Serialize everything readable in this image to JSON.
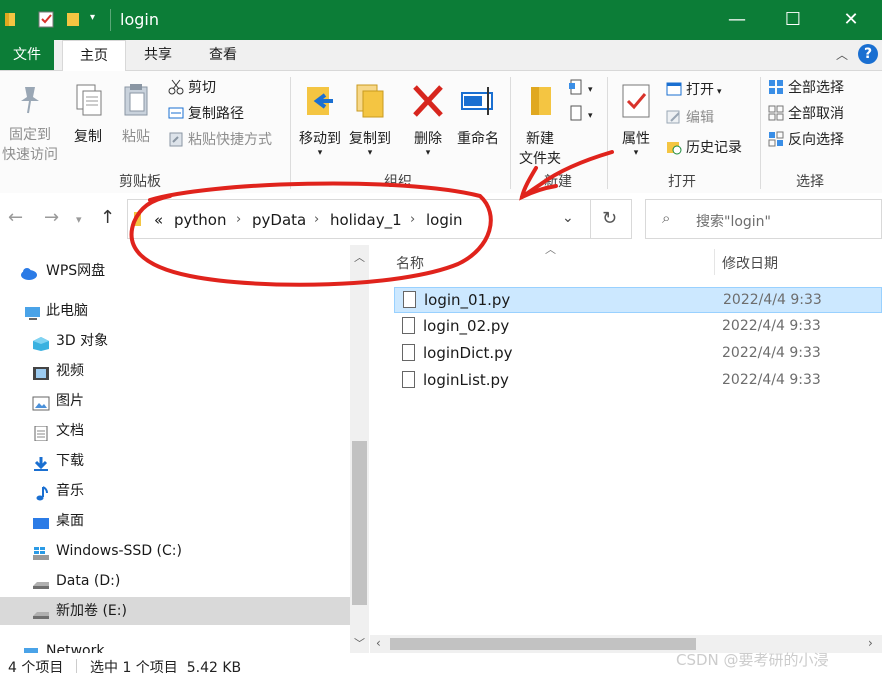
{
  "window": {
    "title": "login",
    "controls": {
      "minimize": "—",
      "maximize": "☐",
      "close": "✕"
    }
  },
  "tabs": [
    "文件",
    "主页",
    "共享",
    "查看"
  ],
  "active_tab": "主页",
  "ribbon": {
    "clipboard": {
      "label": "剪贴板",
      "pin": "固定到\n快速访问",
      "copy": "复制",
      "paste": "粘贴",
      "cut": "剪切",
      "copy_path": "复制路径",
      "paste_shortcut": "粘贴快捷方式"
    },
    "organize": {
      "label": "组织",
      "move_to": "移动到",
      "copy_to": "复制到",
      "delete": "删除",
      "rename": "重命名"
    },
    "new": {
      "label": "新建",
      "new_folder": "新建\n文件夹"
    },
    "open": {
      "label": "打开",
      "properties": "属性",
      "open": "打开",
      "edit": "编辑",
      "history": "历史记录"
    },
    "select": {
      "label": "选择",
      "select_all": "全部选择",
      "select_none": "全部取消",
      "invert": "反向选择"
    }
  },
  "address": {
    "overflow": "«",
    "crumbs": [
      "python",
      "pyData",
      "holiday_1",
      "login"
    ]
  },
  "search": {
    "placeholder": "搜索\"login\""
  },
  "nav": [
    {
      "label": "WPS网盘",
      "icon": "cloud-icon"
    },
    {
      "label": "此电脑",
      "icon": "computer-icon"
    },
    {
      "label": "3D 对象",
      "icon": "3d-objects-icon"
    },
    {
      "label": "视频",
      "icon": "video-icon"
    },
    {
      "label": "图片",
      "icon": "pictures-icon"
    },
    {
      "label": "文档",
      "icon": "documents-icon"
    },
    {
      "label": "下载",
      "icon": "download-icon"
    },
    {
      "label": "音乐",
      "icon": "music-icon"
    },
    {
      "label": "桌面",
      "icon": "desktop-icon"
    },
    {
      "label": "Windows-SSD (C:)",
      "icon": "windows-drive-icon"
    },
    {
      "label": "Data (D:)",
      "icon": "drive-icon"
    },
    {
      "label": "新加卷 (E:)",
      "icon": "drive-icon"
    },
    {
      "label": "Network",
      "icon": "network-icon"
    }
  ],
  "nav_selected": "新加卷 (E:)",
  "columns": {
    "name": "名称",
    "modified": "修改日期"
  },
  "files": [
    {
      "name": "login_01.py",
      "modified": "2022/4/4 9:33",
      "selected": true
    },
    {
      "name": "login_02.py",
      "modified": "2022/4/4 9:33",
      "selected": false
    },
    {
      "name": "loginDict.py",
      "modified": "2022/4/4 9:33",
      "selected": false
    },
    {
      "name": "loginList.py",
      "modified": "2022/4/4 9:33",
      "selected": false
    }
  ],
  "status": {
    "count": "4 个项目",
    "selection": "选中 1 个项目  5.42 KB"
  },
  "watermark": "CSDN @要考研的小浸",
  "colors": {
    "titlebar": "#0c7d37",
    "selection": "#cce8ff",
    "annotation": "#e0231c"
  }
}
